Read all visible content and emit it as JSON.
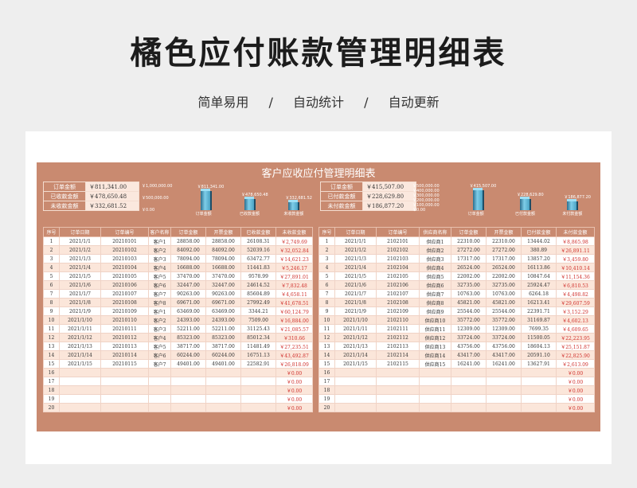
{
  "header": {
    "title": "橘色应付账款管理明细表",
    "tags": [
      "简单易用",
      "自动统计",
      "自动更新"
    ],
    "sep": "/"
  },
  "sheet_title": "客户应收应付管理明细表",
  "left_summary": [
    {
      "label": "订单金额",
      "value": "￥811,341.00"
    },
    {
      "label": "已收款金额",
      "value": "￥478,650.48"
    },
    {
      "label": "未收款金额",
      "value": "￥332,681.52"
    }
  ],
  "right_summary": [
    {
      "label": "订单金额",
      "value": "￥415,507.00"
    },
    {
      "label": "已付款金额",
      "value": "￥228,629.80"
    },
    {
      "label": "未付款金额",
      "value": "￥186,877.20"
    }
  ],
  "chart_data": [
    {
      "type": "bar",
      "categories": [
        "订单金额",
        "已收款金额",
        "未收款金额"
      ],
      "values": [
        811341.0,
        478650.48,
        332681.52
      ],
      "value_labels": [
        "￥811,341.00",
        "￥478,650.48",
        "￥332,681.52"
      ],
      "yticks": [
        "￥1,000,000.00",
        "￥500,000.00",
        "￥0.00"
      ],
      "ylim": [
        0,
        1000000
      ]
    },
    {
      "type": "bar",
      "categories": [
        "订单金额",
        "已付款金额",
        "未付款金额"
      ],
      "values": [
        415507.0,
        228629.8,
        186877.2
      ],
      "value_labels": [
        "￥415,507.00",
        "￥228,629.80",
        "￥186,877.20"
      ],
      "yticks": [
        "￥500,000.00",
        "￥400,000.00",
        "￥300,000.00",
        "￥200,000.00",
        "￥100,000.00",
        "￥0.00"
      ],
      "ylim": [
        0,
        500000
      ]
    }
  ],
  "left_table": {
    "headers": [
      "序号",
      "订单日期",
      "订单编号",
      "客户名称",
      "订单金额",
      "开票金额",
      "已收款金额",
      "未收款金额"
    ],
    "rows": [
      [
        "1",
        "2021/1/1",
        "20210101",
        "客户1",
        "28858.00",
        "28858.00",
        "26108.31",
        "￥2,749.69"
      ],
      [
        "2",
        "2021/1/2",
        "20210102",
        "客户2",
        "84092.00",
        "84092.00",
        "52039.16",
        "￥32,052.84"
      ],
      [
        "3",
        "2021/1/3",
        "20210103",
        "客户3",
        "78094.00",
        "78094.00",
        "63472.77",
        "￥14,621.23"
      ],
      [
        "4",
        "2021/1/4",
        "20210104",
        "客户4",
        "16688.00",
        "16688.00",
        "11441.83",
        "￥5,246.17"
      ],
      [
        "5",
        "2021/1/5",
        "20210105",
        "客户5",
        "37470.00",
        "37470.00",
        "9578.99",
        "￥27,891.01"
      ],
      [
        "6",
        "2021/1/6",
        "20210106",
        "客户6",
        "32447.00",
        "32447.00",
        "24614.52",
        "￥7,832.48"
      ],
      [
        "7",
        "2021/1/7",
        "20210107",
        "客户7",
        "90263.00",
        "90263.00",
        "85604.89",
        "￥4,658.11"
      ],
      [
        "8",
        "2021/1/8",
        "20210108",
        "客户8",
        "69671.00",
        "69671.00",
        "27992.49",
        "￥41,678.51"
      ],
      [
        "9",
        "2021/1/9",
        "20210109",
        "客户1",
        "63469.00",
        "63469.00",
        "3344.21",
        "￥60,124.79"
      ],
      [
        "10",
        "2021/1/10",
        "20210110",
        "客户2",
        "24393.00",
        "24393.00",
        "7509.00",
        "￥16,884.00"
      ],
      [
        "11",
        "2021/1/11",
        "20210111",
        "客户3",
        "52211.00",
        "52211.00",
        "31125.43",
        "￥21,085.57"
      ],
      [
        "12",
        "2021/1/12",
        "20210112",
        "客户4",
        "85323.00",
        "85323.00",
        "85012.34",
        "￥310.66"
      ],
      [
        "13",
        "2021/1/13",
        "20210113",
        "客户5",
        "38717.00",
        "38717.00",
        "11481.49",
        "￥27,235.51"
      ],
      [
        "14",
        "2021/1/14",
        "20210114",
        "客户6",
        "60244.00",
        "60244.00",
        "16751.13",
        "￥43,492.87"
      ],
      [
        "15",
        "2021/1/15",
        "20210115",
        "客户7",
        "49401.00",
        "49401.00",
        "22582.91",
        "￥26,818.09"
      ],
      [
        "16",
        "",
        "",
        "",
        "",
        "",
        "",
        "￥0.00"
      ],
      [
        "17",
        "",
        "",
        "",
        "",
        "",
        "",
        "￥0.00"
      ],
      [
        "18",
        "",
        "",
        "",
        "",
        "",
        "",
        "￥0.00"
      ],
      [
        "19",
        "",
        "",
        "",
        "",
        "",
        "",
        "￥0.00"
      ],
      [
        "20",
        "",
        "",
        "",
        "",
        "",
        "",
        "￥0.00"
      ]
    ]
  },
  "right_table": {
    "headers": [
      "序号",
      "订单日期",
      "订单编号",
      "供应商名称",
      "订单金额",
      "开票金额",
      "已付款金额",
      "未付款金额"
    ],
    "rows": [
      [
        "1",
        "2021/1/1",
        "2102101",
        "供应商1",
        "22310.00",
        "22310.00",
        "13444.02",
        "￥8,865.98"
      ],
      [
        "2",
        "2021/1/2",
        "2102102",
        "供应商2",
        "27272.00",
        "27272.00",
        "380.89",
        "￥26,891.11"
      ],
      [
        "3",
        "2021/1/3",
        "2102103",
        "供应商3",
        "17317.00",
        "17317.00",
        "13857.20",
        "￥3,459.80"
      ],
      [
        "4",
        "2021/1/4",
        "2102104",
        "供应商4",
        "26524.00",
        "26524.00",
        "16113.86",
        "￥10,410.14"
      ],
      [
        "5",
        "2021/1/5",
        "2102105",
        "供应商5",
        "22002.00",
        "22002.00",
        "10847.64",
        "￥11,154.36"
      ],
      [
        "6",
        "2021/1/6",
        "2102106",
        "供应商6",
        "32735.00",
        "32735.00",
        "25924.47",
        "￥6,810.53"
      ],
      [
        "7",
        "2021/1/7",
        "2102107",
        "供应商7",
        "10763.00",
        "10763.00",
        "6264.18",
        "￥4,498.82"
      ],
      [
        "8",
        "2021/1/8",
        "2102108",
        "供应商8",
        "45821.00",
        "45821.00",
        "16213.41",
        "￥29,607.59"
      ],
      [
        "9",
        "2021/1/9",
        "2102109",
        "供应商9",
        "25544.00",
        "25544.00",
        "22391.71",
        "￥3,152.29"
      ],
      [
        "10",
        "2021/1/10",
        "2102110",
        "供应商10",
        "35772.00",
        "35772.00",
        "31169.87",
        "￥4,602.13"
      ],
      [
        "11",
        "2021/1/11",
        "2102111",
        "供应商11",
        "12309.00",
        "12309.00",
        "7699.35",
        "￥4,609.65"
      ],
      [
        "12",
        "2021/1/12",
        "2102112",
        "供应商12",
        "33724.00",
        "33724.00",
        "11500.05",
        "￥22,223.95"
      ],
      [
        "13",
        "2021/1/13",
        "2102113",
        "供应商13",
        "43756.00",
        "43756.00",
        "18604.13",
        "￥25,151.87"
      ],
      [
        "14",
        "2021/1/14",
        "2102114",
        "供应商14",
        "43417.00",
        "43417.00",
        "20591.10",
        "￥22,825.90"
      ],
      [
        "15",
        "2021/1/15",
        "2102115",
        "供应商15",
        "16241.00",
        "16241.00",
        "13627.91",
        "￥2,613.09"
      ],
      [
        "16",
        "",
        "",
        "",
        "",
        "",
        "",
        "￥0.00"
      ],
      [
        "17",
        "",
        "",
        "",
        "",
        "",
        "",
        "￥0.00"
      ],
      [
        "18",
        "",
        "",
        "",
        "",
        "",
        "",
        "￥0.00"
      ],
      [
        "19",
        "",
        "",
        "",
        "",
        "",
        "",
        "￥0.00"
      ],
      [
        "20",
        "",
        "",
        "",
        "",
        "",
        "",
        "￥0.00"
      ]
    ]
  }
}
